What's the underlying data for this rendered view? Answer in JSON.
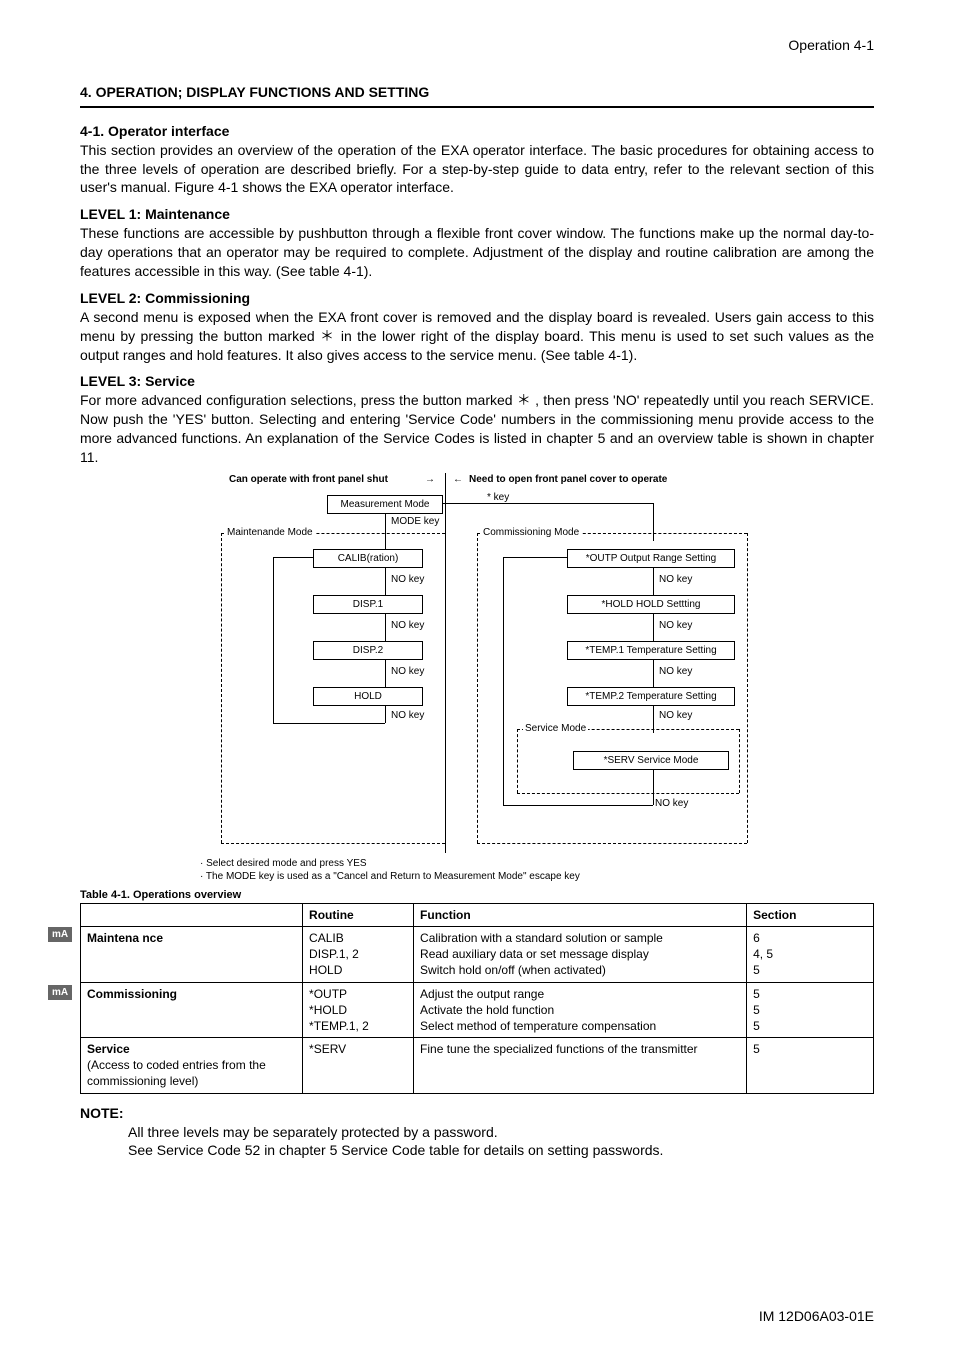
{
  "page_header": "Operation   4-1",
  "section_title": "4. OPERATION; DISPLAY FUNCTIONS AND SETTING",
  "s41_title": "4-1. Operator interface",
  "s41_para": "This section provides an overview of the operation of the EXA operator interface. The basic procedures for obtaining access to the three levels of operation are described briefly. For a step-by-step guide to data entry, refer to the relevant section of this user's manual. Figure 4-1 shows the EXA operator interface.",
  "lvl1_title": "LEVEL 1: Maintenance",
  "lvl1_para": "These functions are accessible by pushbutton through a flexible front cover window. The functions make up the normal day-to-day operations that an operator may be required to complete. Adjustment of the display and routine calibration are among the features accessible in this way. (See table 4-1).",
  "lvl2_title": "LEVEL 2: Commissioning",
  "lvl2_para": "A second menu is exposed when the EXA front cover is removed and the display board is revealed. Users gain access to this menu by pressing the button marked ＊ in the lower right of the display board. This menu is used to set such values as the output ranges and hold features. It also gives access to the service menu. (See table 4-1).",
  "lvl3_title": "LEVEL 3: Service",
  "lvl3_para": "For more advanced configuration selections, press the button marked ＊ , then press 'NO' repeatedly until you reach SERVICE. Now push the 'YES' button. Selecting and entering 'Service Code' numbers in the commissioning menu provide access to the more advanced functions. An explanation of the Service Codes is listed in chapter 5 and an overview table is shown in chapter 11.",
  "diagram": {
    "left_hdr": "Can operate with front panel shut",
    "right_hdr": "Need to open front panel cover to operate",
    "meas_mode": "Measurement Mode",
    "mode_key": "MODE key",
    "star_key": "* key",
    "maint_mode": "Maintenande Mode",
    "comm_mode": "Commissioning Mode",
    "calib": "CALIB(ration)",
    "disp1": "DISP.1",
    "disp2": "DISP.2",
    "hold": "HOLD",
    "no_key": "NO key",
    "outp": "*OUTP Output Range Setting",
    "hold_set": "*HOLD HOLD Settting",
    "temp1": "*TEMP.1 Temperature Setting",
    "temp2": "*TEMP.2 Temperature Setting",
    "serv_mode": "Service Mode",
    "serv": "*SERV Service Mode"
  },
  "footnote1": "· Select desired mode and press YES",
  "footnote2": "· The MODE key is used as a \"Cancel and Return to Measurement Mode\" escape key",
  "table_caption": "Table 4-1. Operations overview",
  "badge": "mA",
  "table": {
    "headers": [
      "",
      "Routine",
      "Function",
      "Section"
    ],
    "rows": [
      {
        "level": "Maintena   nce",
        "routine": "CALIB\nDISP.1, 2\nHOLD",
        "function": "Calibration with a standard solution or sample\nRead auxiliary data or set message display\nSwitch hold on/off (when activated)",
        "section": "6\n4, 5\n5"
      },
      {
        "level": "Commissioning",
        "routine": "*OUTP\n*HOLD\n*TEMP.1, 2",
        "function": "Adjust the output range\nActivate the hold function\nSelect method of temperature compensation",
        "section": "5\n5\n5"
      },
      {
        "level": "Service\n(Access to coded entries from the commissioning level)",
        "routine": "*SERV",
        "function": "Fine tune the specialized functions of the transmitter",
        "section": "5"
      }
    ]
  },
  "note_title": "NOTE:",
  "note1": "All three levels may be separately protected by a password.",
  "note2": "See Service Code 52 in chapter 5 Service Code table for details on setting passwords.",
  "footer": "IM 12D06A03-01E"
}
